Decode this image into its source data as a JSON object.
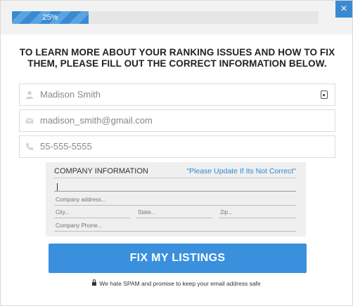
{
  "progress": {
    "label": "25%",
    "value": 0.25
  },
  "close_icon": "×",
  "headline": "TO LEARN MORE ABOUT YOUR RANKING ISSUES AND HOW TO FIX THEM, PLEASE FILL OUT THE CORRECT INFORMATION BELOW.",
  "form": {
    "name": {
      "value": "Madison Smith",
      "icon": "person-icon"
    },
    "email": {
      "value": "madison_smith@gmail.com",
      "icon": "envelope-icon"
    },
    "phone": {
      "value": "55-555-5555",
      "icon": "phone-icon"
    }
  },
  "company": {
    "title": "COMPANY INFORMATION",
    "note": "\"Please Update If Its Not Correct\"",
    "address_placeholder": "Company address...",
    "city_placeholder": "City...",
    "state_placeholder": "State...",
    "zip_placeholder": "Zip...",
    "phone_placeholder": "Company Phone..."
  },
  "cta_label": "FIX MY LISTINGS",
  "spam_note": "We hate SPAM and promise to keep your email address safe",
  "colors": {
    "accent": "#3a90dc",
    "progress": "#3a8ad0",
    "note": "#2d89d2"
  }
}
